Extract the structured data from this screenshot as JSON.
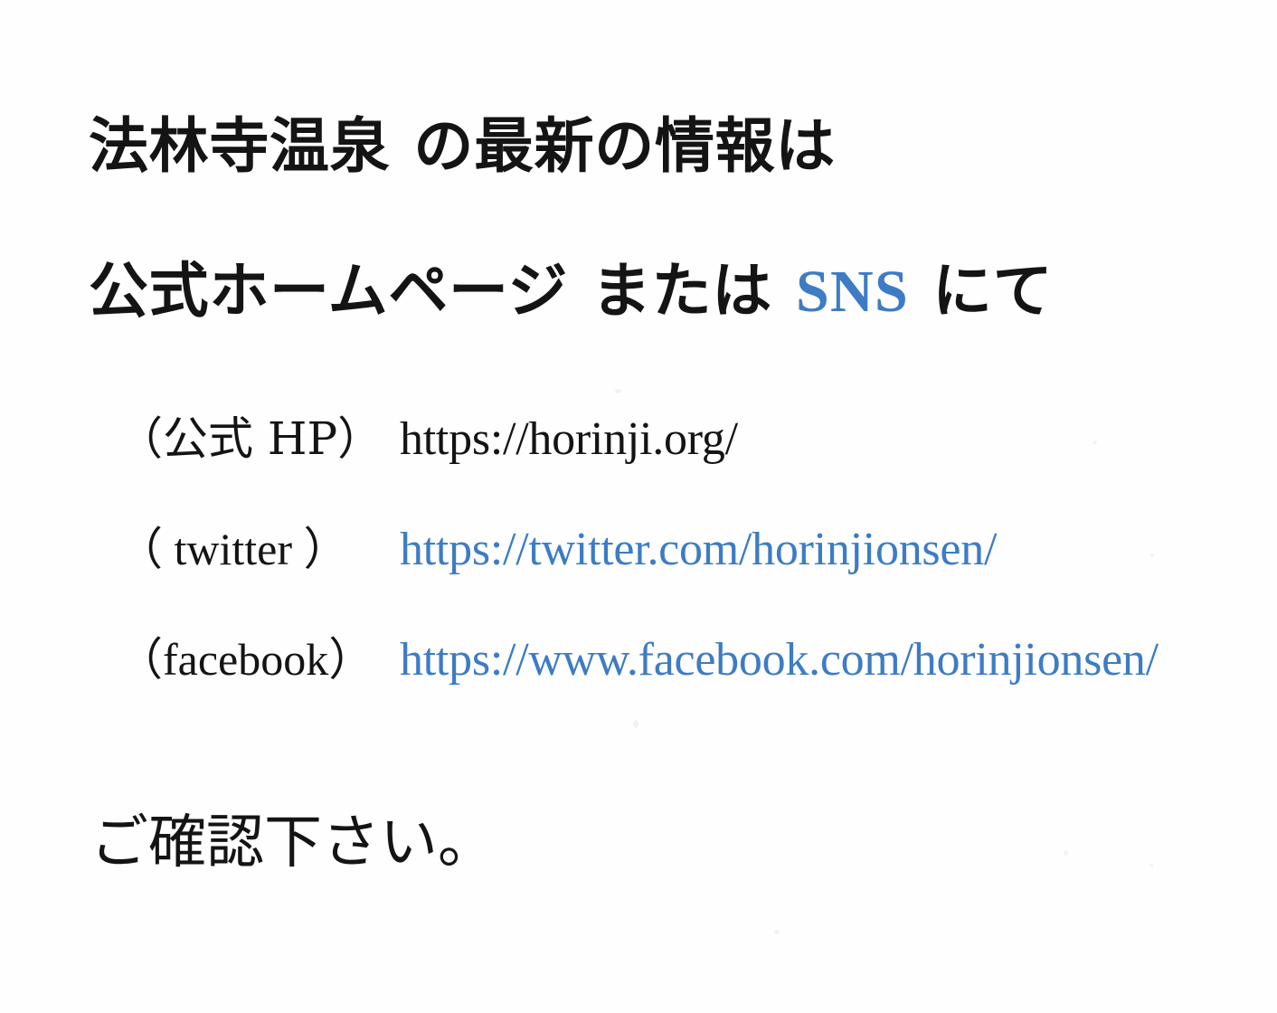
{
  "document": {
    "type": "scanned-notice",
    "language": "ja",
    "background_color": "#ffffff",
    "text_color": "#141414",
    "accent_color": "#3d7cc4"
  },
  "headline": {
    "line1_part1": "法林寺温泉",
    "line1_part2": "の最新の情報は",
    "line2_part1": "公式ホームページ",
    "line2_part2": "または",
    "line2_accent": "SNS",
    "line2_part3": "にて"
  },
  "links": [
    {
      "label": "（公式 HP）",
      "url": "https://horinji.org/",
      "url_color": "#141414",
      "service": "official-homepage"
    },
    {
      "label": "（ twitter ）",
      "url": "https://twitter.com/horinjionsen/",
      "url_color": "#3d7cc4",
      "service": "twitter"
    },
    {
      "label": "（facebook）",
      "url": "https://www.facebook.com/horinjionsen/",
      "url_color": "#3d7cc4",
      "service": "facebook"
    }
  ],
  "closing": {
    "text": "ご確認下さい。"
  }
}
